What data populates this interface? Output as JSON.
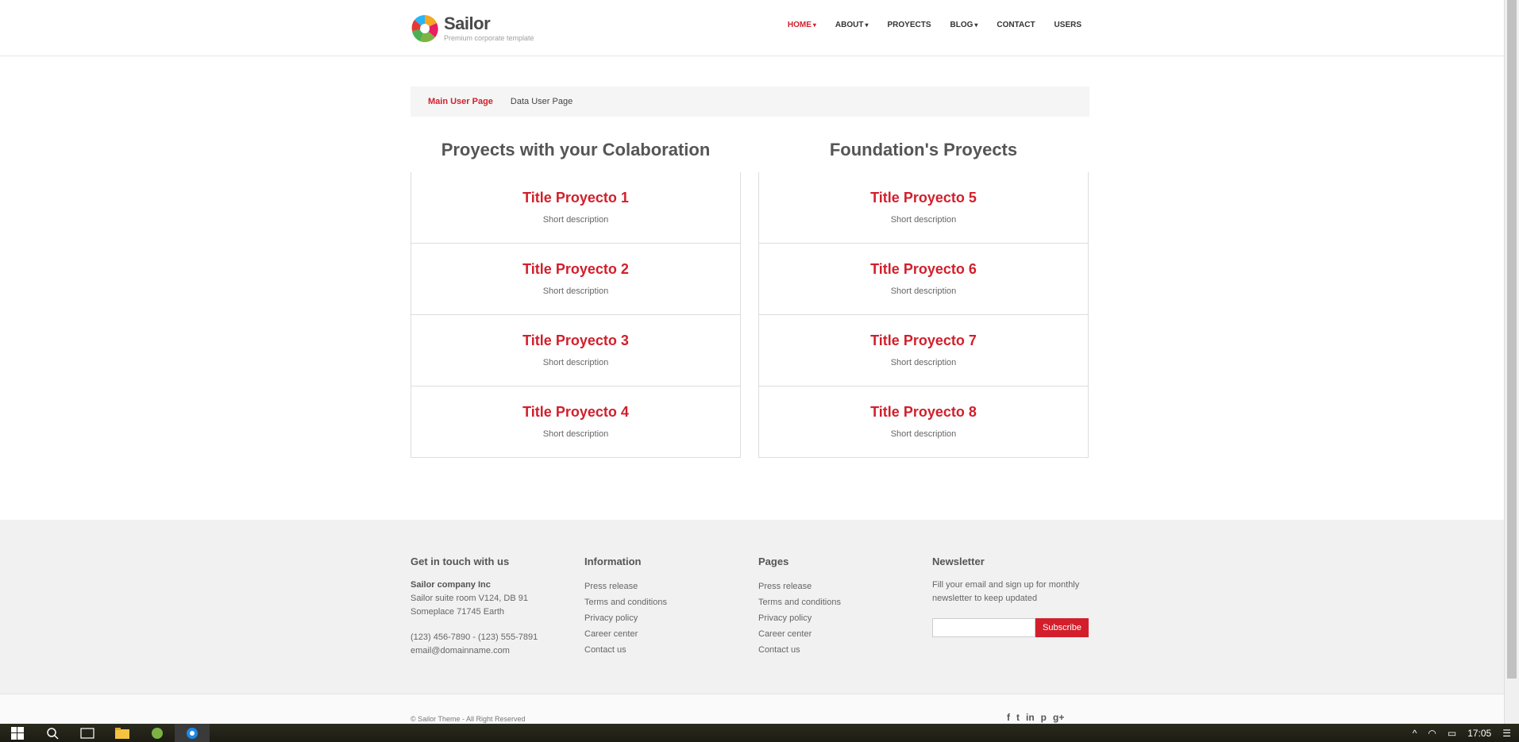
{
  "brand": {
    "name": "Sailor",
    "tagline": "Premium corporate template"
  },
  "nav": [
    {
      "label": "HOME",
      "caret": "▾"
    },
    {
      "label": "ABOUT",
      "caret": "▾"
    },
    {
      "label": "PROYECTS",
      "caret": ""
    },
    {
      "label": "BLOG",
      "caret": "▾"
    },
    {
      "label": "CONTACT",
      "caret": ""
    },
    {
      "label": "USERS",
      "caret": ""
    }
  ],
  "tabs": [
    "Main User Page",
    "Data User Page"
  ],
  "left_column": {
    "title": "Proyects with your Colaboration",
    "cards": [
      {
        "title": "Title Proyecto 1",
        "desc": "Short description"
      },
      {
        "title": "Title Proyecto 2",
        "desc": "Short description"
      },
      {
        "title": "Title Proyecto 3",
        "desc": "Short description"
      },
      {
        "title": "Title Proyecto 4",
        "desc": "Short description"
      }
    ]
  },
  "right_column": {
    "title": "Foundation's Proyects",
    "cards": [
      {
        "title": "Title Proyecto 5",
        "desc": "Short description"
      },
      {
        "title": "Title Proyecto 6",
        "desc": "Short description"
      },
      {
        "title": "Title Proyecto 7",
        "desc": "Short description"
      },
      {
        "title": "Title Proyecto 8",
        "desc": "Short description"
      }
    ]
  },
  "footer": {
    "contact": {
      "heading": "Get in touch with us",
      "company": "Sailor company Inc",
      "address1": "Sailor suite room V124, DB 91",
      "address2": "Someplace 71745 Earth",
      "phone": "(123) 456-7890 - (123) 555-7891",
      "email": "email@domainname.com"
    },
    "information": {
      "heading": "Information",
      "links": [
        "Press release",
        "Terms and conditions",
        "Privacy policy",
        "Career center",
        "Contact us"
      ]
    },
    "pages": {
      "heading": "Pages",
      "links": [
        "Press release",
        "Terms and conditions",
        "Privacy policy",
        "Career center",
        "Contact us"
      ]
    },
    "newsletter": {
      "heading": "Newsletter",
      "text1": "Fill your email and sign up for monthly",
      "text2": "newsletter to keep updated",
      "input_value": "",
      "button": "Subscribe"
    },
    "copyright": "© Sailor Theme - All Right Reserved",
    "social": [
      "f",
      "t",
      "in",
      "p",
      "g+"
    ]
  },
  "taskbar": {
    "time": "17:05"
  },
  "colors": {
    "accent": "#d21f2b",
    "footer_bg": "#f1f1f1"
  }
}
